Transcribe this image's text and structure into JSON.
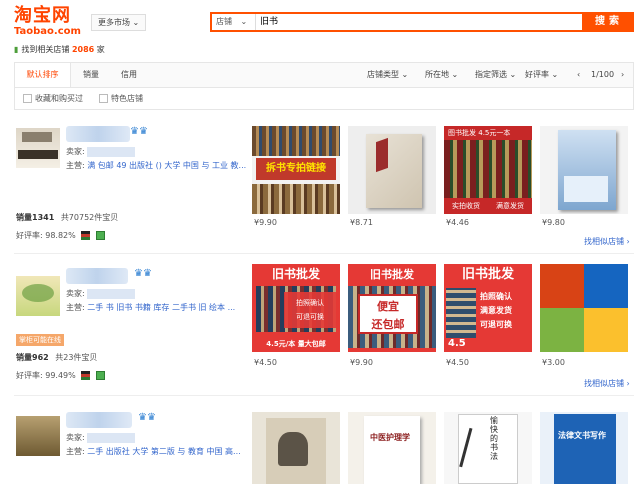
{
  "header": {
    "logo_cn": "淘宝网",
    "logo_en": "Taobao.com",
    "more_market": "更多市场",
    "search_type": "店铺",
    "search_value": "旧书",
    "search_button": "搜索",
    "found_prefix": "找到相关店铺",
    "found_count": "2086",
    "found_suffix": "家"
  },
  "filter": {
    "tabs": [
      "默认排序",
      "销量",
      "信用"
    ],
    "drops": [
      "店铺类型",
      "所在地",
      "指定筛选",
      "好评率"
    ],
    "page": "1/100",
    "checks": [
      "收藏和购买过",
      "特色店铺"
    ]
  },
  "shops": [
    {
      "seller_label": "卖家:",
      "main_label": "主营:",
      "main": "满 包邮 49 出版社 () 大学 中国 与 工业 教...",
      "sales": "销量1341",
      "items": "共70752件宝贝",
      "rate": "好评率: 98.82%",
      "prices": [
        "¥9.90",
        "¥8.71",
        "¥4.46",
        "¥9.80"
      ],
      "more": "找相似店铺 ›"
    },
    {
      "seller_label": "卖家:",
      "main_label": "主营:",
      "main": "二手 书 旧书 书籍 库存 二手书 旧 绘本 ...",
      "warn": "掌柜可能在线",
      "sales": "销量962",
      "items": "共23件宝贝",
      "rate": "好评率: 99.49%",
      "prices": [
        "¥4.50",
        "¥9.90",
        "¥4.50",
        "¥3.00"
      ],
      "more": "找相似店铺 ›"
    },
    {
      "seller_label": "卖家:",
      "main_label": "主营:",
      "main": "二手 出版社 大学 第二版 与 教育 中国 高...",
      "prices": []
    }
  ],
  "products": {
    "s1p1_text": "拆书专拍链接",
    "s1p3_top": "图书批发",
    "s1p3_price": "4.5元一本",
    "s1p3_b1": "实拍收货",
    "s1p3_b2": "满意发货",
    "s2p1_top": "旧书批发",
    "s2p1_l1": "拍照确认",
    "s2p1_l2": "可退可换",
    "s2p1_bottom": "4.5元/本  量大包邮",
    "s2p2_top": "旧书批发",
    "s2p2_mid1": "便宜",
    "s2p2_mid2": "还包邮",
    "s2p3_top": "旧书批发",
    "s2p3_l1": "拍照确认",
    "s2p3_l2": "满意发货",
    "s2p3_l3": "可退可换",
    "s2p3_price": "4.5",
    "s3p2_title": "中医护理学",
    "s3p3_title": "愉快的书法",
    "s3p4_title": "法律文书写作"
  },
  "colors": {
    "accent": "#ff4400",
    "search": "#ff5000",
    "link": "#3366cc"
  }
}
